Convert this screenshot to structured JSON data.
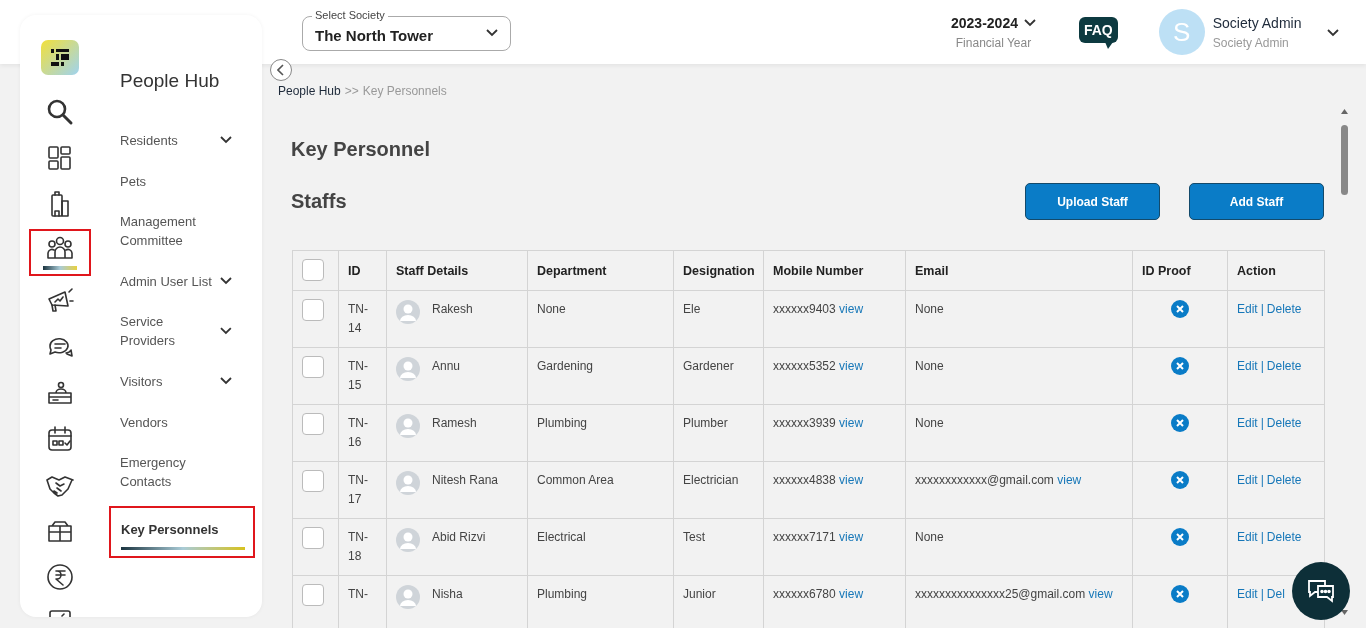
{
  "rail": [
    {
      "selected": false
    },
    {
      "selected": false
    },
    {
      "selected": false
    },
    {
      "selected": true
    },
    {
      "selected": false
    },
    {
      "selected": false
    },
    {
      "selected": false
    },
    {
      "selected": false
    },
    {
      "selected": false
    },
    {
      "selected": false
    },
    {
      "selected": false
    }
  ],
  "menu": {
    "title": "People Hub",
    "items": [
      {
        "label": "Residents",
        "expandable": true,
        "selected": false
      },
      {
        "label": "Pets",
        "expandable": false,
        "selected": false
      },
      {
        "label": "Management Committee",
        "expandable": false,
        "selected": false
      },
      {
        "label": "Admin User List",
        "expandable": true,
        "selected": false
      },
      {
        "label": "Service Providers",
        "expandable": true,
        "selected": false
      },
      {
        "label": "Visitors",
        "expandable": true,
        "selected": false
      },
      {
        "label": "Vendors",
        "expandable": false,
        "selected": false
      },
      {
        "label": "Emergency Contacts",
        "expandable": false,
        "selected": false
      },
      {
        "label": "Key Personnels",
        "expandable": false,
        "selected": true
      }
    ]
  },
  "header": {
    "society": {
      "label": "Select Society",
      "value": "The North Tower"
    },
    "year": {
      "value": "2023-2024",
      "caption": "Financial Year"
    },
    "faq": "FAQ",
    "user": {
      "initial": "S",
      "name": "Society Admin",
      "role": "Society Admin"
    }
  },
  "breadcrumb": {
    "parent": "People Hub",
    "separator": ">>",
    "current": "Key Personnels"
  },
  "page_title": "Key Personnel",
  "section_title": "Staffs",
  "buttons": [
    "Upload Staff",
    "Add Staff"
  ],
  "table": {
    "select_all_checked": false,
    "columns": [
      "ID",
      "Staff Details",
      "Department",
      "Designation",
      "Mobile Number",
      "Email",
      "ID Proof",
      "Action"
    ],
    "rows": [
      {
        "checked": false,
        "id": "TN-14",
        "name": "Rakesh",
        "department": "None",
        "designation": "Ele",
        "mobile": "xxxxxx9403",
        "mobile_link": "view",
        "email": "None",
        "id_proof": false,
        "edit": "Edit",
        "separator": "|",
        "delete": "Delete"
      },
      {
        "checked": false,
        "id": "TN-15",
        "name": "Annu",
        "department": "Gardening",
        "designation": "Gardener",
        "mobile": "xxxxxx5352",
        "mobile_link": "view",
        "email": "None",
        "id_proof": false,
        "edit": "Edit",
        "separator": "|",
        "delete": "Delete"
      },
      {
        "checked": false,
        "id": "TN-16",
        "name": "Ramesh",
        "department": "Plumbing",
        "designation": "Plumber",
        "mobile": "xxxxxx3939",
        "mobile_link": "view",
        "email": "None",
        "id_proof": false,
        "edit": "Edit",
        "separator": "|",
        "delete": "Delete"
      },
      {
        "checked": false,
        "id": "TN-17",
        "name": "Nitesh Rana",
        "department": "Common Area",
        "designation": "Electrician",
        "mobile": "xxxxxx4838",
        "mobile_link": "view",
        "email": "xxxxxxxxxxxx@gmail.com",
        "email_link": "view",
        "id_proof": false,
        "edit": "Edit",
        "separator": "|",
        "delete": "Delete"
      },
      {
        "checked": false,
        "id": "TN-18",
        "name": "Abid Rizvi",
        "department": "Electrical",
        "designation": "Test",
        "mobile": "xxxxxx7171",
        "mobile_link": "view",
        "email": "None",
        "id_proof": false,
        "edit": "Edit",
        "separator": "|",
        "delete": "Delete"
      },
      {
        "checked": false,
        "id": "TN-",
        "name": "Nisha",
        "department": "Plumbing",
        "designation": "Junior",
        "mobile": "xxxxxx6780",
        "mobile_link": "view",
        "email": "xxxxxxxxxxxxxxx25@gmail.com",
        "email_link": "view",
        "id_proof": false,
        "edit": "Edit",
        "separator": "|",
        "delete": "Del"
      }
    ]
  }
}
